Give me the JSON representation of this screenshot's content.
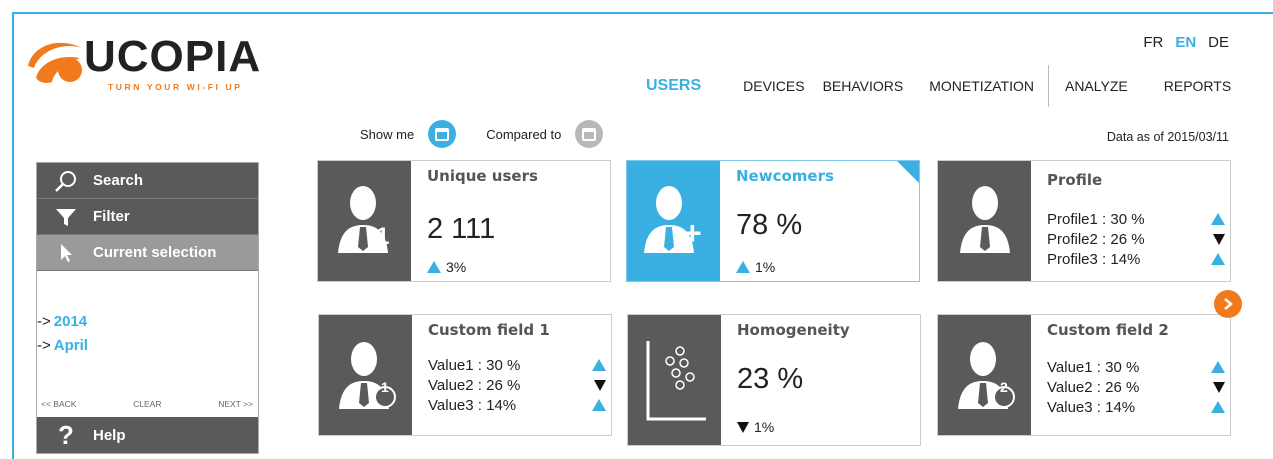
{
  "logo": {
    "word": "UCOPIA",
    "tagline": "TURN YOUR WI-FI UP"
  },
  "langs": [
    {
      "label": "FR",
      "active": false
    },
    {
      "label": "EN",
      "active": true
    },
    {
      "label": "DE",
      "active": false
    }
  ],
  "nav": {
    "users": "USERS",
    "devices": "DEVICES",
    "behaviors": "BEHAVIORS",
    "monetization": "MONETIZATION",
    "analyze": "ANALYZE",
    "reports": "REPORTS"
  },
  "toolbar": {
    "show_me": "Show me",
    "compared_to": "Compared to",
    "data_as_of": "Data as of 2015/03/11"
  },
  "sidebar": {
    "search": "Search",
    "filter": "Filter",
    "current_selection": "Current selection",
    "selections": [
      {
        "arrow": "->",
        "value": "2014"
      },
      {
        "arrow": "->",
        "value": "April"
      }
    ],
    "back": "<< BACK",
    "clear": "CLEAR",
    "next": "NEXT >>",
    "help": "Help"
  },
  "cards": {
    "unique_users": {
      "title": "Unique users",
      "value": "2 111",
      "delta": "3%",
      "direction": "up",
      "badge": "1"
    },
    "newcomers": {
      "title": "Newcomers",
      "value": "78 %",
      "delta": "1%",
      "direction": "up",
      "badge": "+"
    },
    "profile": {
      "title": "Profile",
      "rows": [
        {
          "label": "Profile1 : 30 %",
          "dir": "up"
        },
        {
          "label": "Profile2 : 26 %",
          "dir": "down"
        },
        {
          "label": "Profile3 : 14%",
          "dir": "up"
        }
      ]
    },
    "custom1": {
      "title": "Custom field 1",
      "rows": [
        {
          "label": "Value1 : 30 %",
          "dir": "up"
        },
        {
          "label": "Value2 : 26 %",
          "dir": "down"
        },
        {
          "label": "Value3 : 14%",
          "dir": "up"
        }
      ],
      "badge": "1"
    },
    "homogeneity": {
      "title": "Homogeneity",
      "value": "23 %",
      "delta": "1%",
      "direction": "down"
    },
    "custom2": {
      "title": "Custom field 2",
      "rows": [
        {
          "label": "Value1 : 30 %",
          "dir": "up"
        },
        {
          "label": "Value2 : 26 %",
          "dir": "down"
        },
        {
          "label": "Value3 : 14%",
          "dir": "up"
        }
      ],
      "badge": "2"
    }
  },
  "colors": {
    "accent": "#3ab0e2",
    "orange": "#f07a1c",
    "tile": "#5a5a5a"
  }
}
